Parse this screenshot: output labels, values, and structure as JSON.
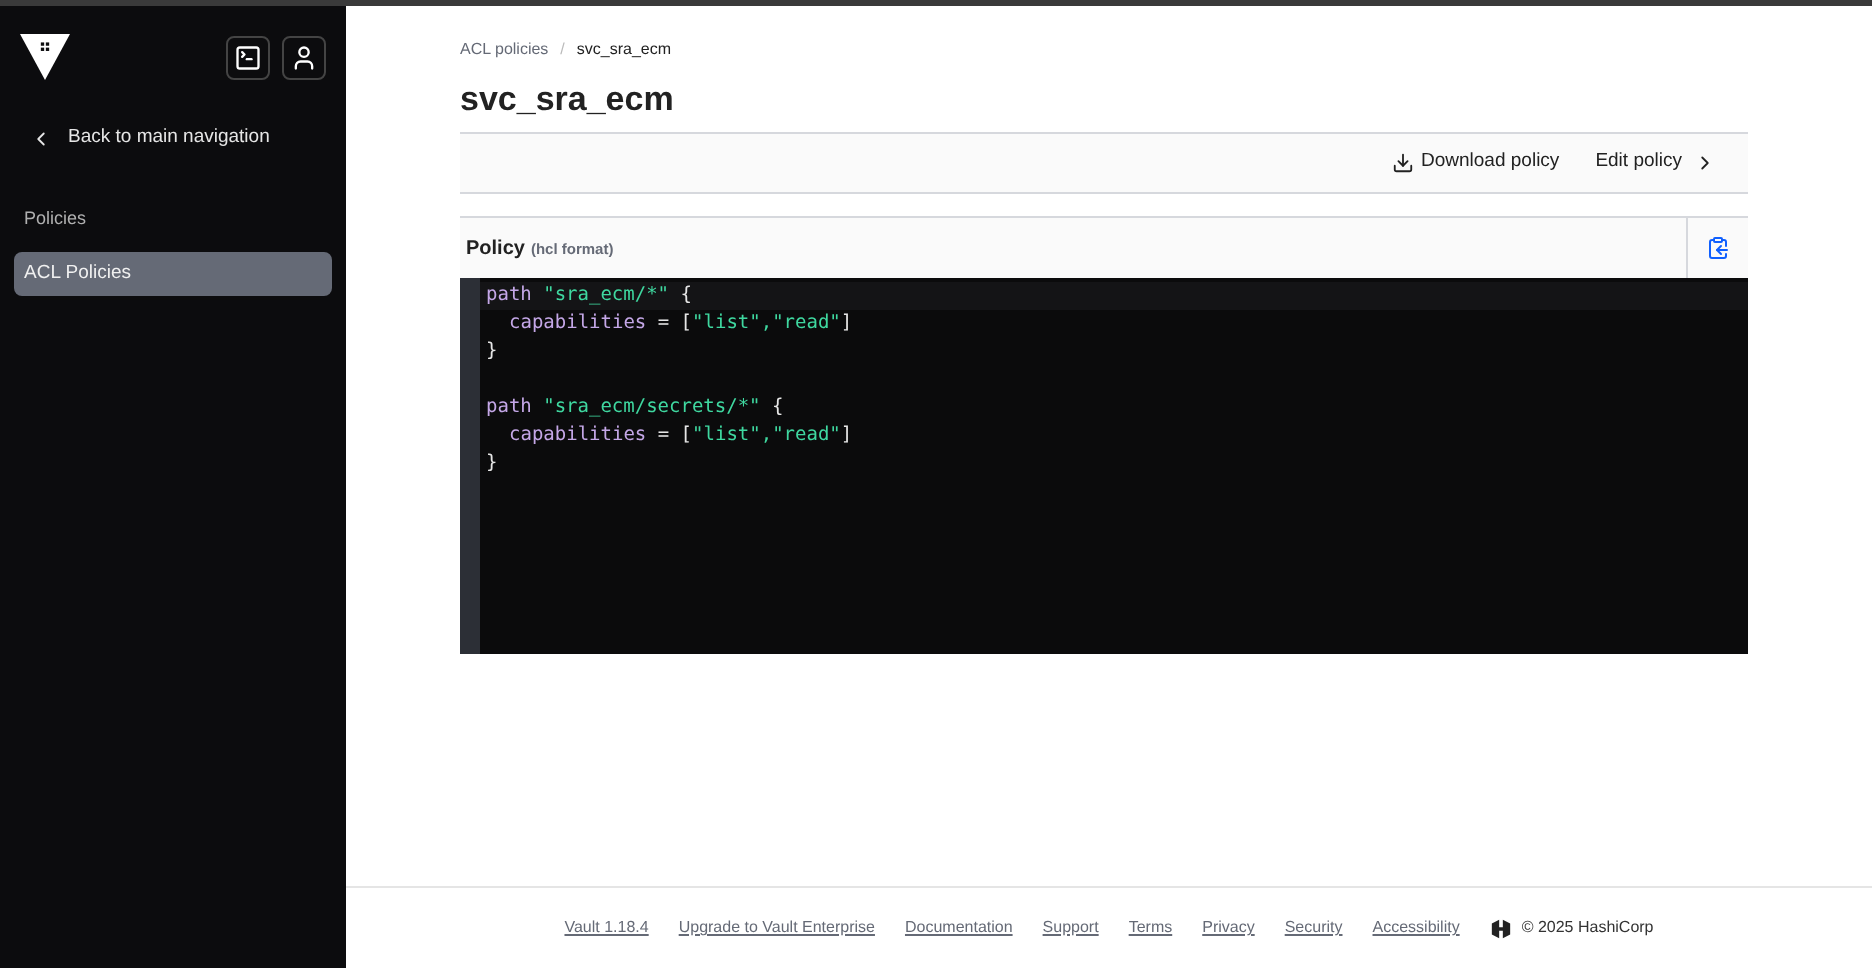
{
  "sidebar": {
    "back_link": "Back to main navigation",
    "section_title": "Policies",
    "items": [
      {
        "label": "ACL Policies",
        "selected": true
      }
    ]
  },
  "breadcrumbs": [
    "ACL policies",
    "svc_sra_ecm"
  ],
  "breadcrumb_separator": "/",
  "title": "svc_sra_ecm",
  "toolbar": {
    "download": "Download policy",
    "edit": "Edit policy"
  },
  "policy": {
    "label": "Policy",
    "format": "(hcl format)",
    "blocks": [
      {
        "lines": [
          {
            "indented": false,
            "tokens": [
              {
                "kind": "keyword",
                "text": "path "
              },
              {
                "kind": "string",
                "text": "\"sra_ecm/*\""
              },
              {
                "kind": "plain",
                "text": " {"
              }
            ]
          },
          {
            "indented": true,
            "tokens": [
              {
                "kind": "keyword",
                "text": "capabilities"
              },
              {
                "kind": "plain",
                "text": " = ["
              },
              {
                "kind": "string",
                "text": "\"list\",\"read\""
              },
              {
                "kind": "plain",
                "text": "]"
              }
            ]
          },
          {
            "indented": false,
            "tokens": [
              {
                "kind": "plain",
                "text": "}"
              }
            ]
          }
        ]
      },
      {
        "lines": [
          {
            "indented": false,
            "tokens": [
              {
                "kind": "keyword",
                "text": "path "
              },
              {
                "kind": "string",
                "text": "\"sra_ecm/secrets/*\""
              },
              {
                "kind": "plain",
                "text": " {"
              }
            ]
          },
          {
            "indented": true,
            "tokens": [
              {
                "kind": "keyword",
                "text": "capabilities"
              },
              {
                "kind": "plain",
                "text": " = ["
              },
              {
                "kind": "string",
                "text": "\"list\",\"read\""
              },
              {
                "kind": "plain",
                "text": "]"
              }
            ]
          },
          {
            "indented": false,
            "tokens": [
              {
                "kind": "plain",
                "text": "}"
              }
            ]
          }
        ]
      }
    ]
  },
  "footer": {
    "links": [
      "Vault 1.18.4",
      "Upgrade to Vault Enterprise",
      "Documentation",
      "Support",
      "Terms",
      "Privacy",
      "Security",
      "Accessibility"
    ],
    "copyright": "© 2025 HashiCorp"
  }
}
